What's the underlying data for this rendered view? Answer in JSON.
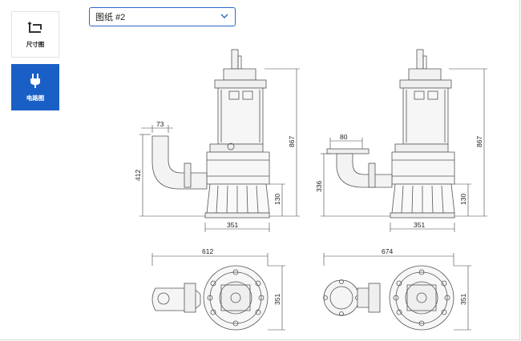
{
  "sidebar": {
    "items": [
      {
        "label": "尺寸图",
        "icon": "crop-dimensions-icon",
        "active": false
      },
      {
        "label": "电路图",
        "icon": "plug-icon",
        "active": true
      }
    ]
  },
  "drawing_select": {
    "value": "图纸 #2",
    "icon": "chevron-down-icon"
  },
  "colors": {
    "accent": "#1a5fc5",
    "line": "#555555"
  },
  "drawing": {
    "left_pump": {
      "outlet_width": "73",
      "outlet_height": "412",
      "total_height": "867",
      "base_height": "130",
      "base_width": "351"
    },
    "right_pump": {
      "flange_width": "80",
      "outlet_height": "336",
      "total_height": "867",
      "base_height": "130",
      "base_width": "351"
    },
    "left_plan": {
      "length": "612",
      "width": "351"
    },
    "right_plan": {
      "length": "674",
      "width": "351"
    }
  }
}
